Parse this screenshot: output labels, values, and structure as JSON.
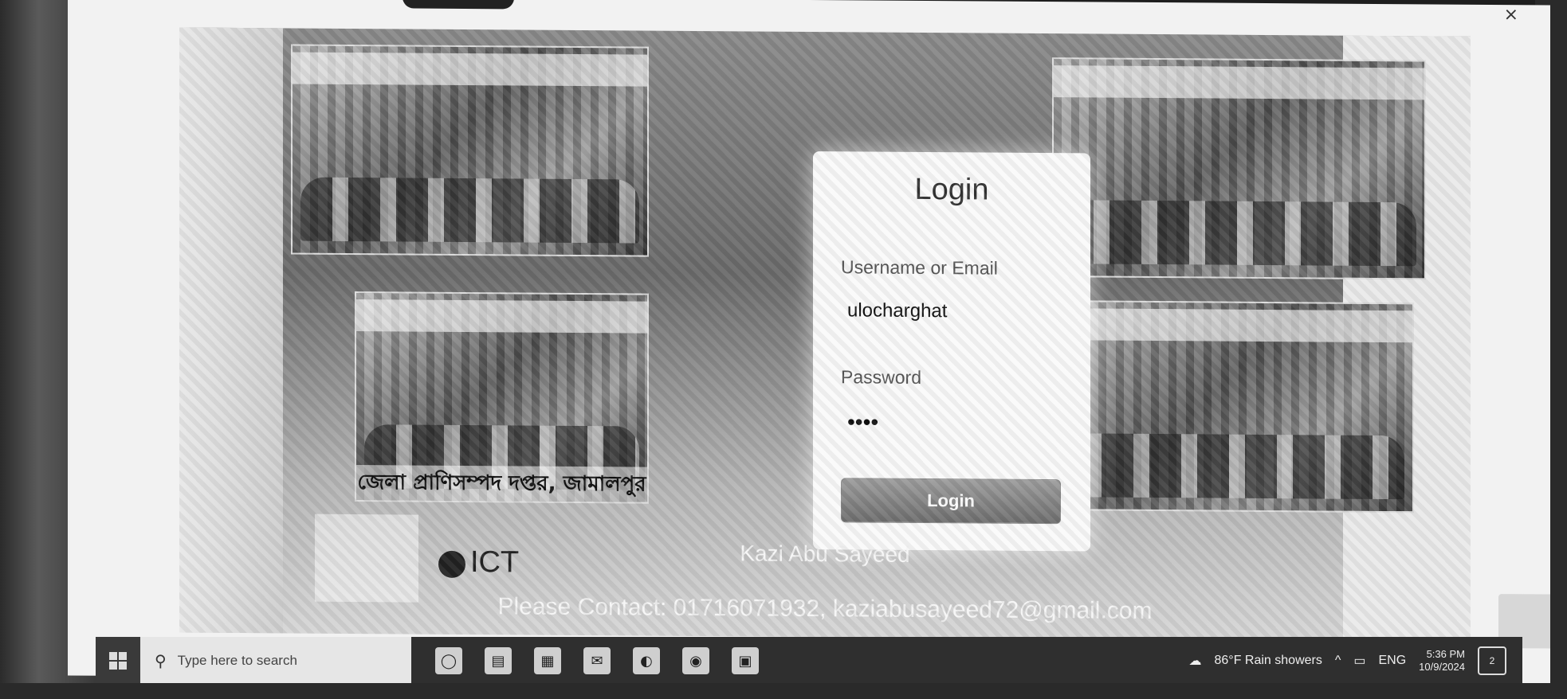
{
  "login": {
    "title": "Login",
    "username_label": "Username or Email",
    "username_value": "ulocharghat",
    "password_label": "Password",
    "password_value": "••••",
    "button_label": "Login"
  },
  "photos": {
    "caption_bottom_left": "জেলা প্রাণিসম্পদ দপ্তর, জামালপুর"
  },
  "logos": {
    "ict_label": "ICT"
  },
  "contact": {
    "name": "Kazi Abu Sayeed",
    "line": "Please Contact: 01716071932, kaziabusayeed72@gmail.com"
  },
  "window": {
    "close_symbol": "×"
  },
  "taskbar": {
    "search_placeholder": "Type here to search",
    "weather": "86°F  Rain showers",
    "language": "ENG",
    "time": "5:36 PM",
    "date": "10/9/2024",
    "notification_count": "2"
  },
  "colors": {
    "taskbar_bg": "#2f2f2f",
    "card_bg": "#fafafa",
    "button_bg": "#7f7f7f"
  }
}
